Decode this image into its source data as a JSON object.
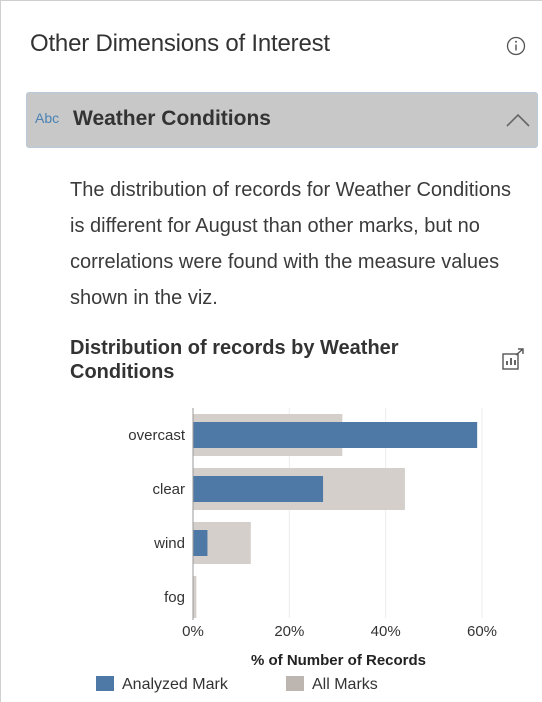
{
  "panel": {
    "title": "Other Dimensions of Interest",
    "info_icon": "info-circle-icon"
  },
  "section": {
    "type_badge": "Abc",
    "label": "Weather Conditions",
    "expanded": true,
    "toggle_icon": "chevron-up-icon",
    "description": "The distribution of records for Weather Conditions is different for August than other marks, but no correlations were found with the measure values shown in the viz."
  },
  "chart_header": {
    "title": "Distribution of records by Weather Conditions",
    "popout_icon": "open-chart-icon"
  },
  "chart_data": {
    "type": "bar",
    "orientation": "horizontal",
    "categories": [
      "overcast",
      "clear",
      "wind",
      "fog"
    ],
    "series": [
      {
        "name": "Analyzed Mark",
        "color": "#4e79a7",
        "values": [
          59,
          27,
          3,
          0
        ]
      },
      {
        "name": "All Marks",
        "color": "#d4cfcb",
        "values": [
          31,
          44,
          12,
          0.7
        ]
      }
    ],
    "xlabel": "% of Number of Records",
    "xlim": [
      0,
      60
    ],
    "xticks": [
      "0%",
      "20%",
      "40%",
      "60%"
    ],
    "grid": true,
    "legend": "bottom"
  },
  "legend": {
    "analyzed": {
      "label": "Analyzed Mark",
      "color": "#4e79a7"
    },
    "all": {
      "label": "All Marks",
      "color": "#bdb5b0"
    }
  }
}
